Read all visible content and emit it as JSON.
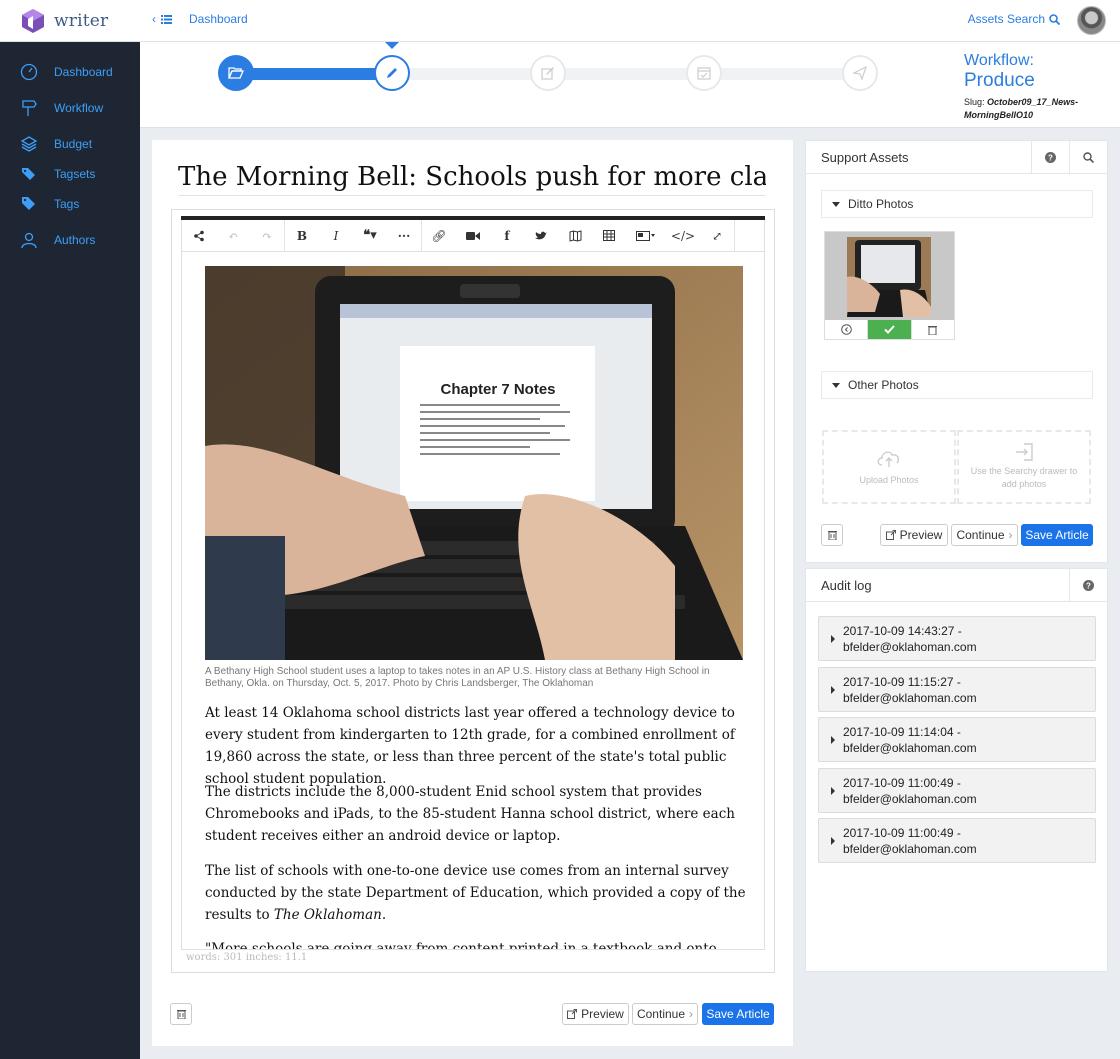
{
  "app": {
    "name": "writer"
  },
  "topbar": {
    "back_label": "Dashboard",
    "assets_search_label": "Assets Search"
  },
  "sidebar": {
    "items": [
      {
        "label": "Dashboard",
        "icon": "dashboard-gauge-icon"
      },
      {
        "label": "Workflow",
        "icon": "signpost-icon"
      },
      {
        "label": "Budget",
        "icon": "layers-icon"
      },
      {
        "label": "Tagsets",
        "icon": "tags-icon"
      },
      {
        "label": "Tags",
        "icon": "tag-icon"
      },
      {
        "label": "Authors",
        "icon": "user-icon"
      }
    ]
  },
  "workflow": {
    "title_prefix": "Workflow:",
    "stage": "Produce",
    "slug_label": "Slug:",
    "slug_value": "October09_17_News-MorningBellO10",
    "progress_fraction": 0.25,
    "steps": [
      "folder-open-icon",
      "pencil-icon",
      "edit-icon",
      "calendar-check-icon",
      "send-icon"
    ],
    "accent_color": "#2b7de1"
  },
  "article": {
    "headline": "The Morning Bell: Schools push for more classrooi",
    "photo_screen_title": "Chapter 7 Notes",
    "caption": "A Bethany High School student uses a laptop to takes notes in an AP U.S. History class at Bethany High School in Bethany, Okla. on Thursday, Oct. 5, 2017. Photo by Chris Landsberger, The Oklahoman",
    "paragraphs": [
      "At least 14 Oklahoma school districts last year offered a technology device to every student from kindergarten to 12th grade, for a combined enrollment of 19,860 across the state, or less than three percent of the state's total public school student population.",
      "The districts include the 8,000-student Enid school system that provides Chromebooks and iPads, to the 85-student Hanna school district, where each student receives either an android device or laptop.",
      "The list of schools with one-to-one device use comes from an internal survey conducted by the state Department of Education, which provided a copy of the results to ",
      "\"More schools are going away from content printed in a textbook and onto devices,\" said"
    ],
    "paragraph3_italic": "The Oklahoman",
    "paragraph3_end": ".",
    "wordcount": "words: 301 inches: 11.1"
  },
  "actions": {
    "preview": "Preview",
    "continue": "Continue",
    "save": "Save Article"
  },
  "support_assets": {
    "title": "Support Assets",
    "ditto_label": "Ditto Photos",
    "other_label": "Other Photos",
    "upload_label": "Upload Photos",
    "searchy_label": "Use the Searchy drawer to add photos"
  },
  "audit_log": {
    "title": "Audit log",
    "entries": [
      {
        "time": "2017-10-09 14:43:27 -",
        "user": "bfelder@oklahoman.com"
      },
      {
        "time": "2017-10-09 11:15:27 -",
        "user": "bfelder@oklahoman.com"
      },
      {
        "time": "2017-10-09 11:14:04 -",
        "user": "bfelder@oklahoman.com"
      },
      {
        "time": "2017-10-09 11:00:49 -",
        "user": "bfelder@oklahoman.com"
      },
      {
        "time": "2017-10-09 11:00:49 -",
        "user": "bfelder@oklahoman.com"
      }
    ]
  }
}
